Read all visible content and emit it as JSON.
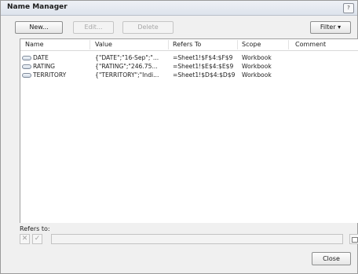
{
  "window": {
    "title": "Name Manager",
    "help_glyph": "?"
  },
  "toolbar": {
    "new_label": "New...",
    "edit_label": "Edit...",
    "delete_label": "Delete",
    "filter_label": "Filter",
    "filter_arrow": "▾"
  },
  "list": {
    "headers": [
      "Name",
      "Value",
      "Refers To",
      "Scope",
      "Comment"
    ],
    "rows": [
      {
        "name": "DATE",
        "value": "{\"DATE\";\"16-Sep\";\"...",
        "refers_to": "=Sheet1!$F$4:$F$9",
        "scope": "Workbook",
        "comment": ""
      },
      {
        "name": "RATING",
        "value": "{\"RATING\";\"246.75...",
        "refers_to": "=Sheet1!$E$4:$E$9",
        "scope": "Workbook",
        "comment": ""
      },
      {
        "name": "TERRITORY",
        "value": "{\"TERRITORY\";\"Indi...",
        "refers_to": "=Sheet1!$D$4:$D$9",
        "scope": "Workbook",
        "comment": ""
      }
    ]
  },
  "refers": {
    "label": "Refers to:",
    "cancel_glyph": "✕",
    "confirm_glyph": "✓",
    "value": ""
  },
  "footer": {
    "close_label": "Close"
  }
}
